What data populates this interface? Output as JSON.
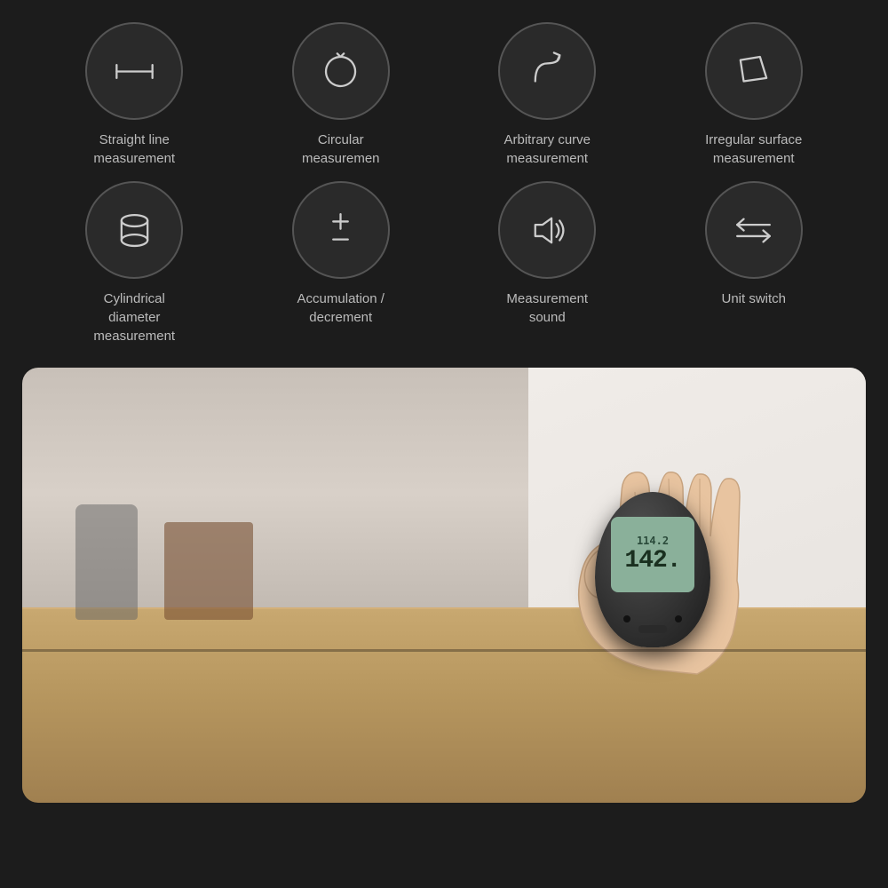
{
  "background_color": "#1e1e1e",
  "features": {
    "row1": [
      {
        "id": "straight-line",
        "label": "Straight line\nmeasurement",
        "icon_type": "straight-line-icon"
      },
      {
        "id": "circular",
        "label": "Circular\nmeasuremen",
        "icon_type": "circular-icon"
      },
      {
        "id": "arbitrary-curve",
        "label": "Arbitrary curve\nmeasurement",
        "icon_type": "curve-icon"
      },
      {
        "id": "irregular-surface",
        "label": "Irregular surface\nmeasurement",
        "icon_type": "irregular-icon"
      }
    ],
    "row2": [
      {
        "id": "cylindrical",
        "label": "Cylindrical\ndiameter\nmeasurement",
        "icon_type": "cylinder-icon"
      },
      {
        "id": "accumulation",
        "label": "Accumulation /\ndecrement",
        "icon_type": "plusminus-icon"
      },
      {
        "id": "sound",
        "label": "Measurement\nsound",
        "icon_type": "sound-icon"
      },
      {
        "id": "unit-switch",
        "label": "Unit switch",
        "icon_type": "switch-icon"
      }
    ]
  },
  "device": {
    "screen_top": "114.2",
    "screen_main": "142."
  }
}
